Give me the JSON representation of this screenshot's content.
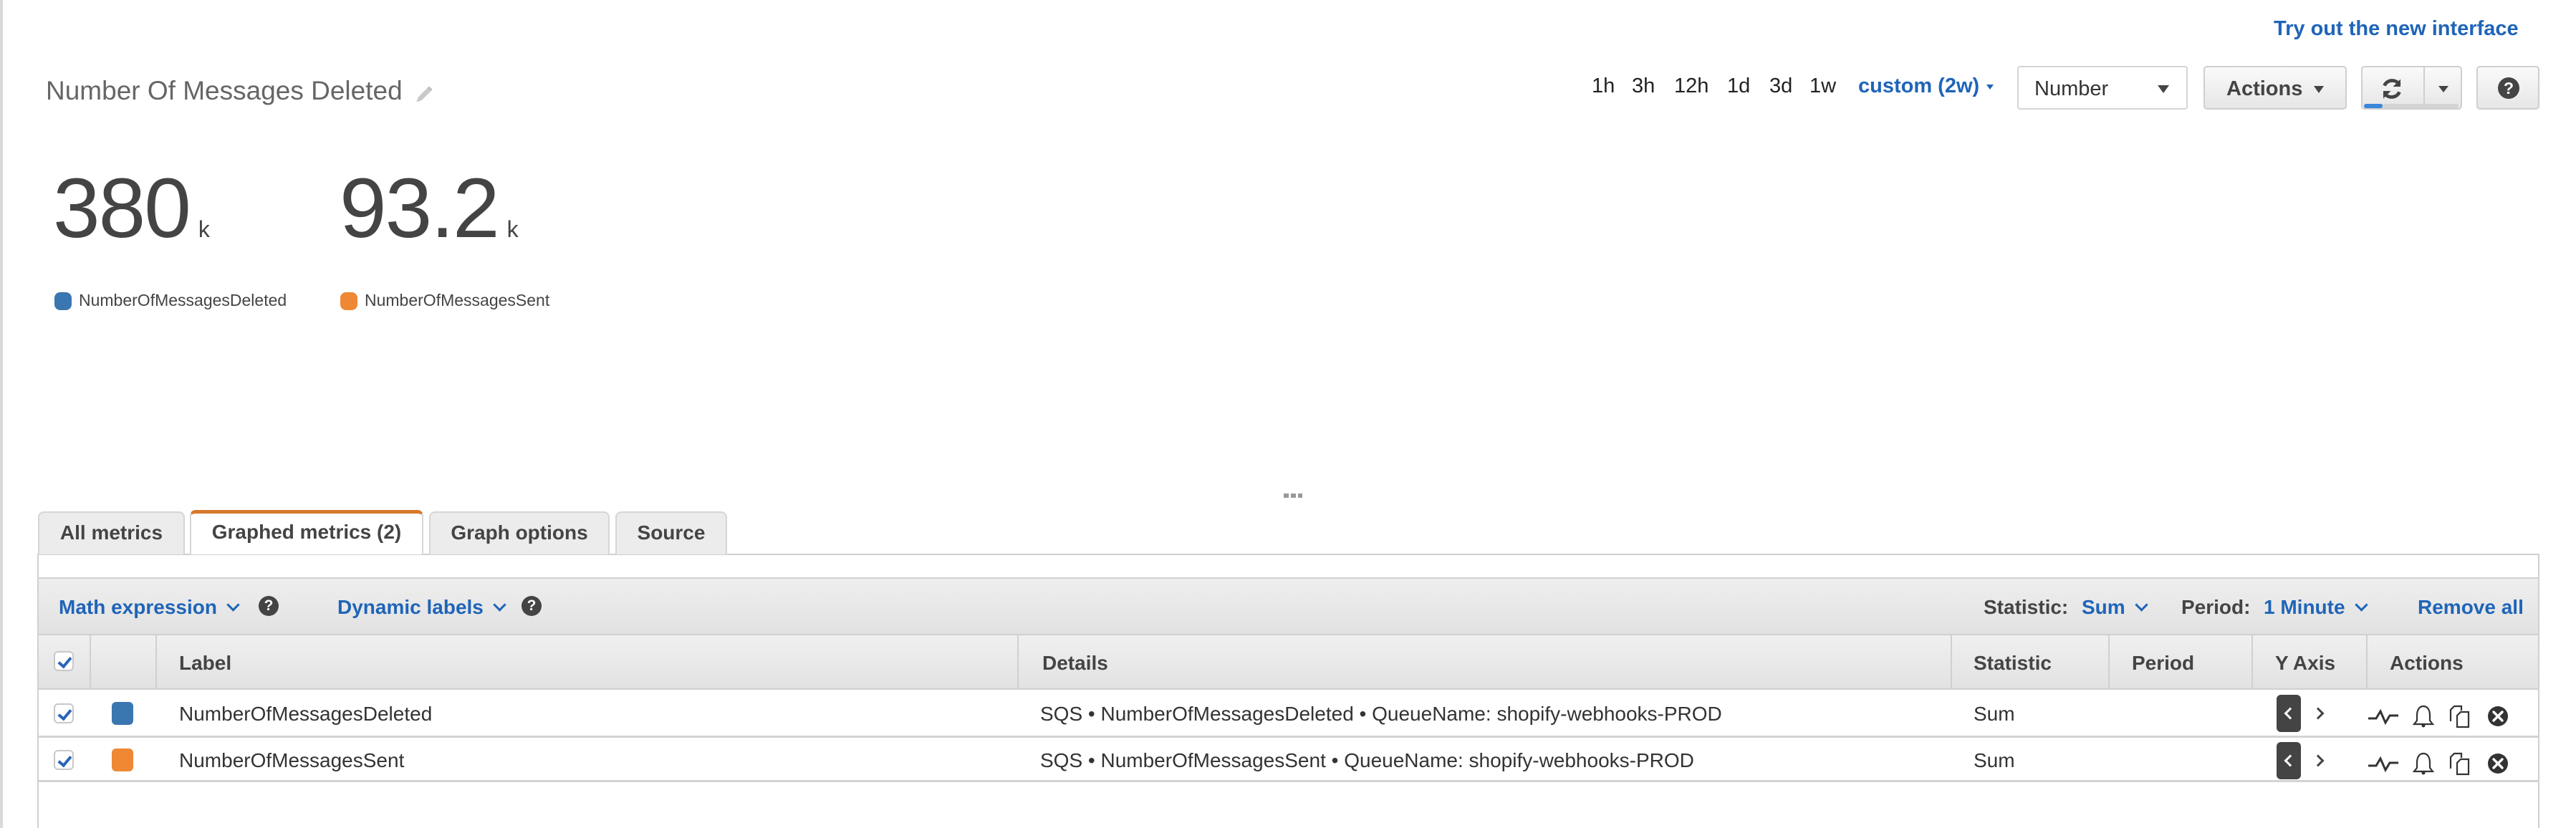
{
  "header": {
    "new_interface_link": "Try out the new interface",
    "graph_title": "Number Of Messages Deleted",
    "time_ranges": [
      "1h",
      "3h",
      "12h",
      "1d",
      "3d",
      "1w"
    ],
    "custom_range": "custom (2w)",
    "view_type_select": "Number",
    "actions_label": "Actions"
  },
  "number_widget": {
    "metrics": [
      {
        "value": "380",
        "unit": "k",
        "label": "NumberOfMessagesDeleted",
        "color": "#3a76b0"
      },
      {
        "value": "93.2",
        "unit": "k",
        "label": "NumberOfMessagesSent",
        "color": "#ef8834"
      }
    ]
  },
  "tabs": [
    {
      "label": "All metrics",
      "active": false
    },
    {
      "label": "Graphed metrics (2)",
      "active": true
    },
    {
      "label": "Graph options",
      "active": false
    },
    {
      "label": "Source",
      "active": false
    }
  ],
  "toolbar": {
    "math_expression": "Math expression",
    "dynamic_labels": "Dynamic labels",
    "statistic_label": "Statistic:",
    "statistic_value": "Sum",
    "period_label": "Period:",
    "period_value": "1 Minute",
    "remove_all": "Remove all"
  },
  "table": {
    "columns": [
      "Label",
      "Details",
      "Statistic",
      "Period",
      "Y Axis",
      "Actions"
    ],
    "select_all_checked": true,
    "rows": [
      {
        "checked": true,
        "color": "#3a76b0",
        "label": "NumberOfMessagesDeleted",
        "details": "SQS • NumberOfMessagesDeleted • QueueName: shopify-webhooks-PROD",
        "statistic": "Sum",
        "period": "",
        "y_axis": "left"
      },
      {
        "checked": true,
        "color": "#ef8834",
        "label": "NumberOfMessagesSent",
        "details": "SQS • NumberOfMessagesSent • QueueName: shopify-webhooks-PROD",
        "statistic": "Sum",
        "period": "",
        "y_axis": "left"
      }
    ]
  },
  "colors": {
    "link_blue": "#1f64b8",
    "active_tab_accent": "#d5792a"
  }
}
